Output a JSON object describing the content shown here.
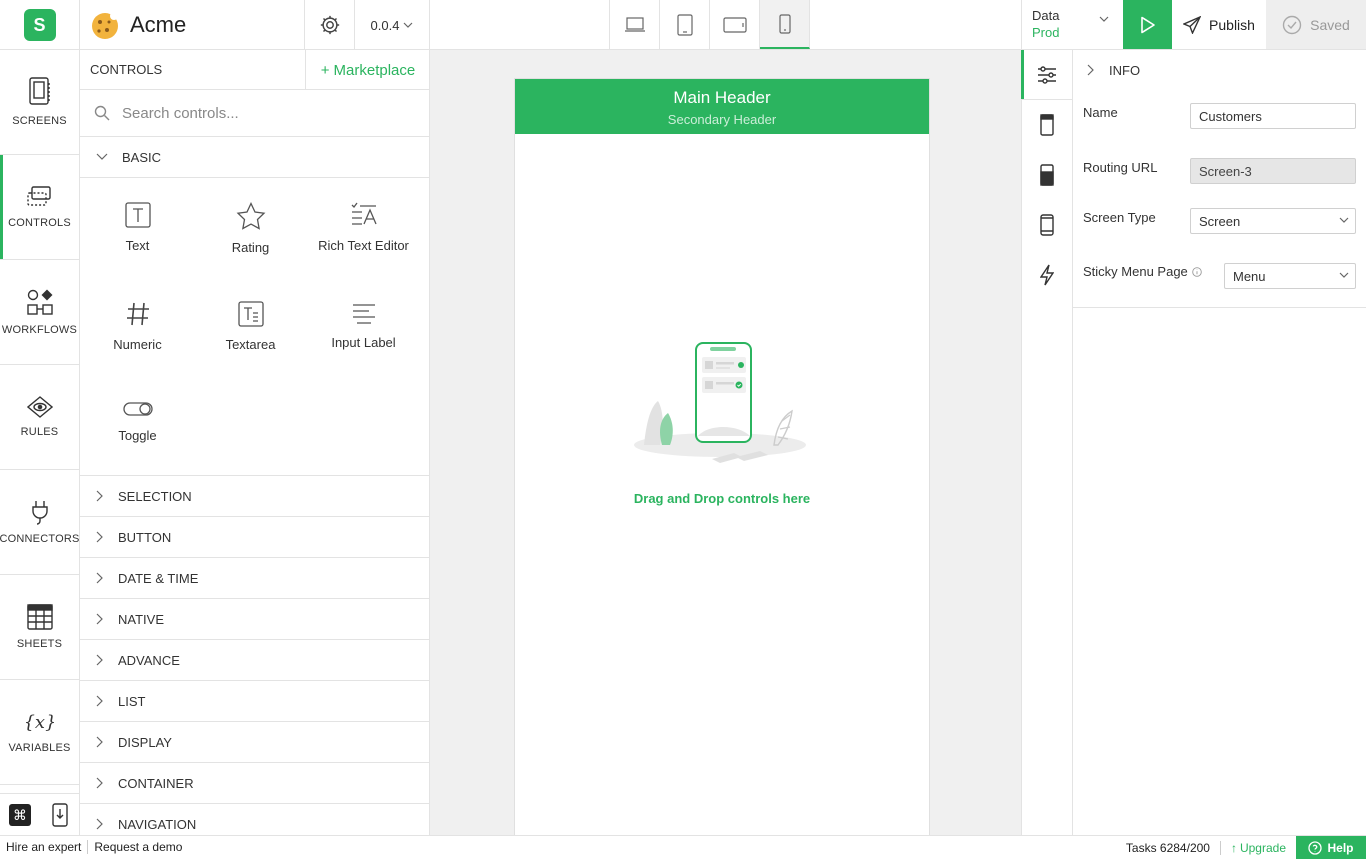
{
  "app": {
    "logo_letter": "S",
    "project_name": "Acme",
    "version": "0.0.4"
  },
  "topbar": {
    "devices": [
      "laptop-icon",
      "tablet-portrait-icon",
      "tablet-landscape-icon",
      "mobile-icon"
    ],
    "active_device": "mobile-icon",
    "data_label": "Data",
    "data_env": "Prod",
    "publish_label": "Publish",
    "saved_label": "Saved"
  },
  "leftnav": {
    "items": [
      {
        "label": "SCREENS",
        "icon": "screens-icon"
      },
      {
        "label": "CONTROLS",
        "icon": "controls-icon",
        "active": true
      },
      {
        "label": "WORKFLOWS",
        "icon": "workflows-icon"
      },
      {
        "label": "RULES",
        "icon": "rules-eye-icon"
      },
      {
        "label": "CONNECTORS",
        "icon": "plug-icon"
      },
      {
        "label": "SHEETS",
        "icon": "sheets-icon"
      },
      {
        "label": "VARIABLES",
        "icon": "variables-icon"
      }
    ]
  },
  "controls": {
    "title": "CONTROLS",
    "marketplace_label": "Marketplace",
    "search_placeholder": "Search controls...",
    "basic_label": "BASIC",
    "basic_items": [
      "Text",
      "Rating",
      "Rich Text Editor",
      "Numeric",
      "Textarea",
      "Input Label",
      "Toggle"
    ],
    "sections": [
      "SELECTION",
      "BUTTON",
      "DATE & TIME",
      "NATIVE",
      "ADVANCE",
      "LIST",
      "DISPLAY",
      "CONTAINER",
      "NAVIGATION"
    ]
  },
  "canvas": {
    "main_header": "Main Header",
    "secondary_header": "Secondary Header",
    "drop_text": "Drag and Drop controls here"
  },
  "props": {
    "section_title": "INFO",
    "name_label": "Name",
    "name_value": "Customers",
    "routing_label": "Routing URL",
    "routing_value": "Screen-3",
    "screen_type_label": "Screen Type",
    "screen_type_value": "Screen",
    "sticky_label": "Sticky Menu Page",
    "sticky_value": "Menu"
  },
  "footer": {
    "hire_label": "Hire an expert",
    "demo_label": "Request a demo",
    "tasks_label": "Tasks 6284/200",
    "upgrade_label": "Upgrade",
    "help_label": "Help"
  },
  "colors": {
    "accent": "#2bb45f"
  }
}
